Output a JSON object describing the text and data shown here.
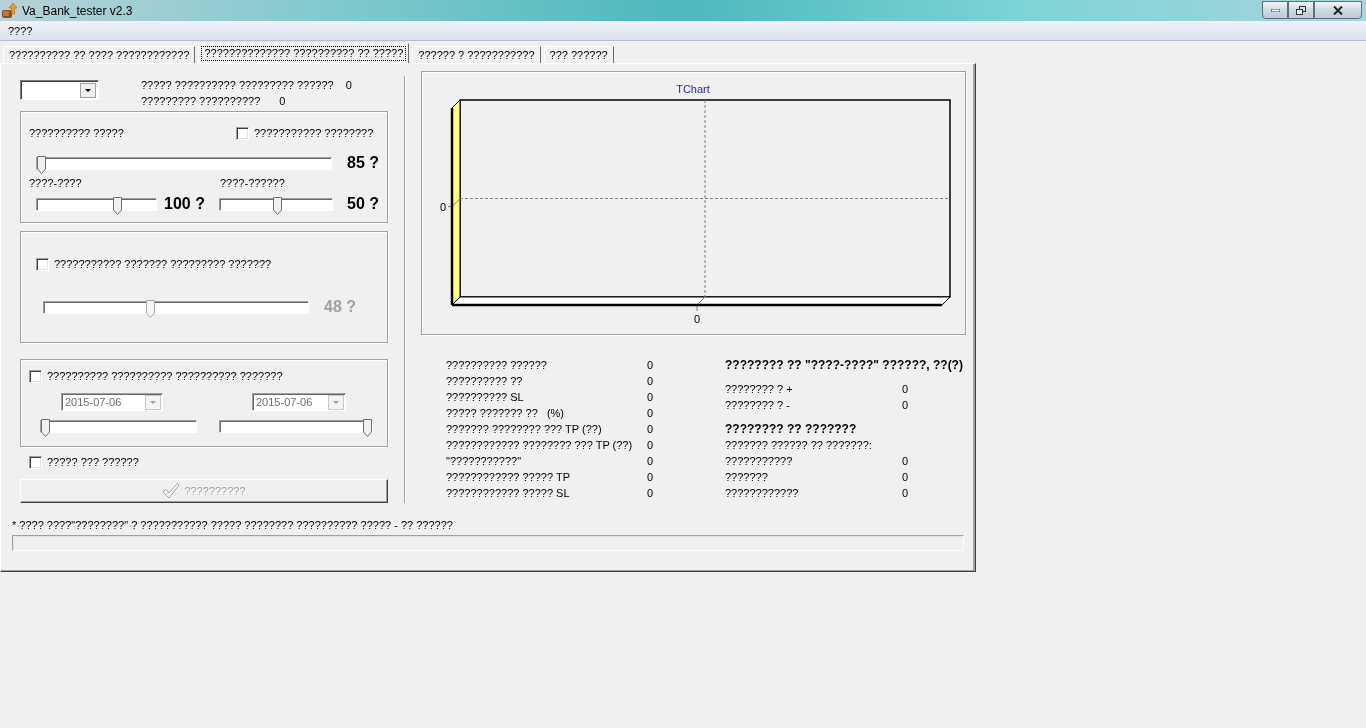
{
  "window": {
    "title": "Va_Bank_tester v2.3"
  },
  "menu": [
    {
      "label": "????"
    }
  ],
  "tabs": [
    {
      "label": "?????????? ?? ???? ????????????",
      "selected": false
    },
    {
      "label": "?????????????? ?????????? ?? ?????",
      "selected": true
    },
    {
      "label": "?????? ? ???????????",
      "selected": false
    },
    {
      "label": "??? ??????",
      "selected": false
    }
  ],
  "top_stats": [
    {
      "label": "????? ?????????? ????????? ??????",
      "value": "0"
    },
    {
      "label": "????????? ??????????",
      "value": "0"
    }
  ],
  "range_group": {
    "label": "?????????? ?????",
    "checkbox": {
      "label": "??????????? ????????",
      "checked": false
    },
    "main_slider": {
      "level": 0,
      "reading": "85 ?"
    },
    "sub_sliders": [
      {
        "label": "????-????",
        "level": 0.69,
        "reading": "100 ?"
      },
      {
        "label": "????-??????",
        "level": 0.51,
        "reading": "50 ?"
      }
    ]
  },
  "filter_group": {
    "checkbox": {
      "label": "??????????? ??????? ????????? ???????",
      "checked": false
    },
    "slider": {
      "level": 0.4,
      "reading": "48 ?",
      "disabled": true
    }
  },
  "date_group": {
    "checkbox": {
      "label": "?????????? ?????????? ?????????? ???????",
      "checked": false
    },
    "ranges": [
      {
        "date": "2015-07-06",
        "disabled": true,
        "slider": {
          "level": 0
        }
      },
      {
        "date": "2015-07-06",
        "disabled": true,
        "slider": {
          "level": 1
        }
      }
    ]
  },
  "extra_checkbox": {
    "label": "????? ??? ??????",
    "checked": false
  },
  "run_button": {
    "label": "??????????",
    "disabled": true
  },
  "chart": {
    "title": "TChart",
    "y_tick_labels": [
      "0"
    ],
    "x_tick_labels": [
      "0"
    ]
  },
  "stats": {
    "left": [
      {
        "label": "?????????? ??????",
        "value": "0"
      },
      {
        "label": "?????????? ??",
        "value": "0"
      },
      {
        "label": "?????????? SL",
        "value": "0"
      },
      {
        "label": "????? ??????? ??   (%)",
        "value": "0"
      },
      {
        "label": "??????? ???????? ??? TP (??)",
        "value": "0"
      },
      {
        "label": "???????????? ???????? ??? TP (??)",
        "value": "0"
      },
      {
        "label": "\"???????????\"",
        "value": "0"
      },
      {
        "label": "???????????? ????? TP",
        "value": "0"
      },
      {
        "label": "???????????? ????? SL",
        "value": "0"
      }
    ],
    "right": [
      {
        "kind": "heading",
        "label": "???????? ?? \"????-????\" ??????, ??(?)"
      },
      {
        "kind": "row",
        "label": "???????? ? +",
        "value": "0"
      },
      {
        "kind": "row",
        "label": "???????? ? -",
        "value": "0"
      },
      {
        "kind": "heading",
        "label": "???????? ?? ???????"
      },
      {
        "kind": "text",
        "label": "??????? ?????? ?? ???????:"
      },
      {
        "kind": "row",
        "label": "???????????",
        "value": "0"
      },
      {
        "kind": "row",
        "label": "???????",
        "value": "0"
      },
      {
        "kind": "row",
        "label": "????????????",
        "value": "0"
      }
    ]
  },
  "note": "* ???? ????\"????????\" ? ??????????? ????? ???????? ?????????? ????? - ?? ??????"
}
